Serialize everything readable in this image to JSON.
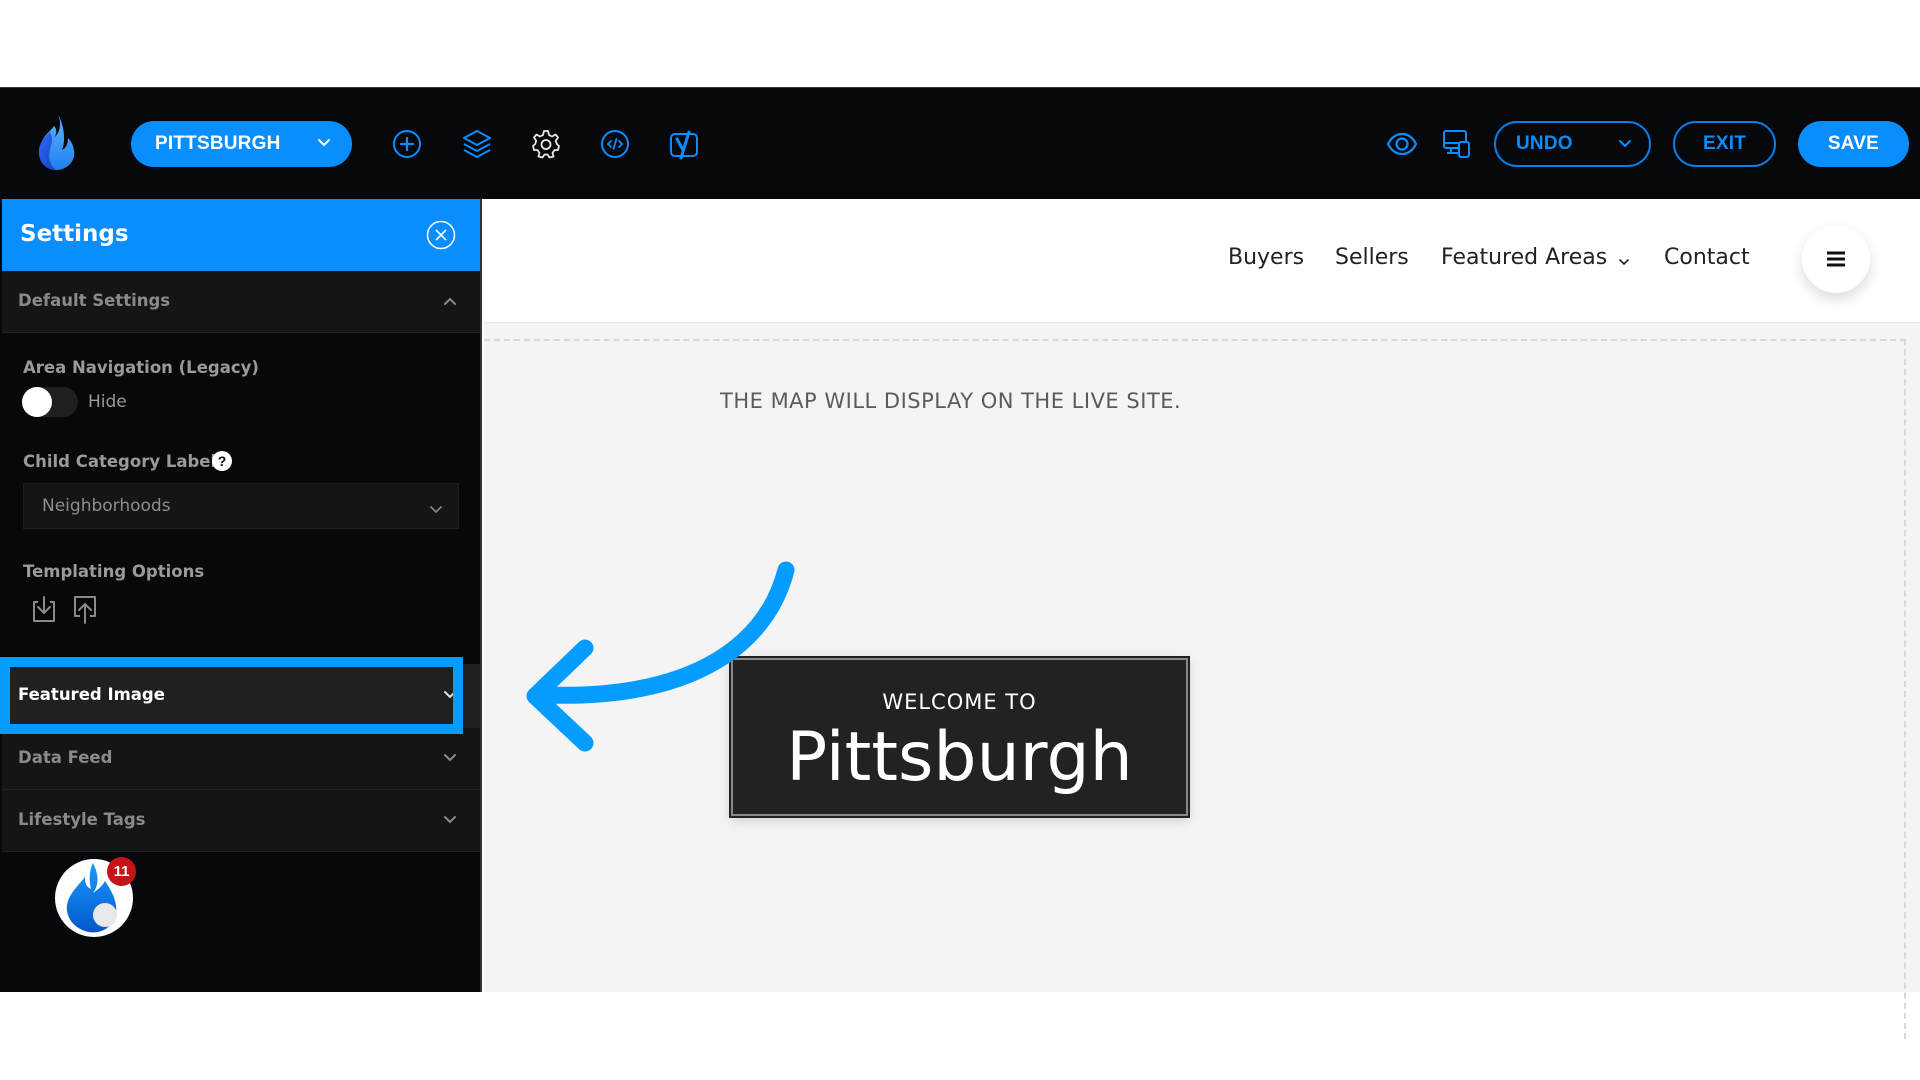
{
  "topbar": {
    "site_selector": "PITTSBURGH",
    "icons": [
      "plus-circle-icon",
      "layers-icon",
      "gear-icon",
      "code-icon",
      "yoast-icon"
    ],
    "right_icons": [
      "eye-icon",
      "devices-icon"
    ],
    "undo_label": "UNDO",
    "exit_label": "EXIT",
    "save_label": "SAVE"
  },
  "sidebar": {
    "title": "Settings",
    "default_settings": "Default Settings",
    "area_navigation_label": "Area Navigation (Legacy)",
    "area_navigation_toggle": "Hide",
    "area_navigation_on": false,
    "child_category_label": "Child Category Label",
    "help_glyph": "?",
    "child_category_value": "Neighborhoods",
    "templating_label": "Templating Options",
    "sections": [
      {
        "label": "Featured Image",
        "highlighted": true
      },
      {
        "label": "Data Feed"
      },
      {
        "label": "Lifestyle Tags"
      }
    ],
    "chat_badge": "11"
  },
  "preview": {
    "nav": [
      "Buyers",
      "Sellers",
      "Featured Areas",
      "Contact"
    ],
    "map_message": "THE MAP WILL DISPLAY ON THE LIVE SITE.",
    "welcome_small": "WELCOME TO",
    "welcome_big": "Pittsburgh"
  },
  "colors": {
    "accent": "#0a8dff",
    "annotation": "#049cff",
    "header_bg": "#07080b",
    "badge": "#c4141a"
  }
}
